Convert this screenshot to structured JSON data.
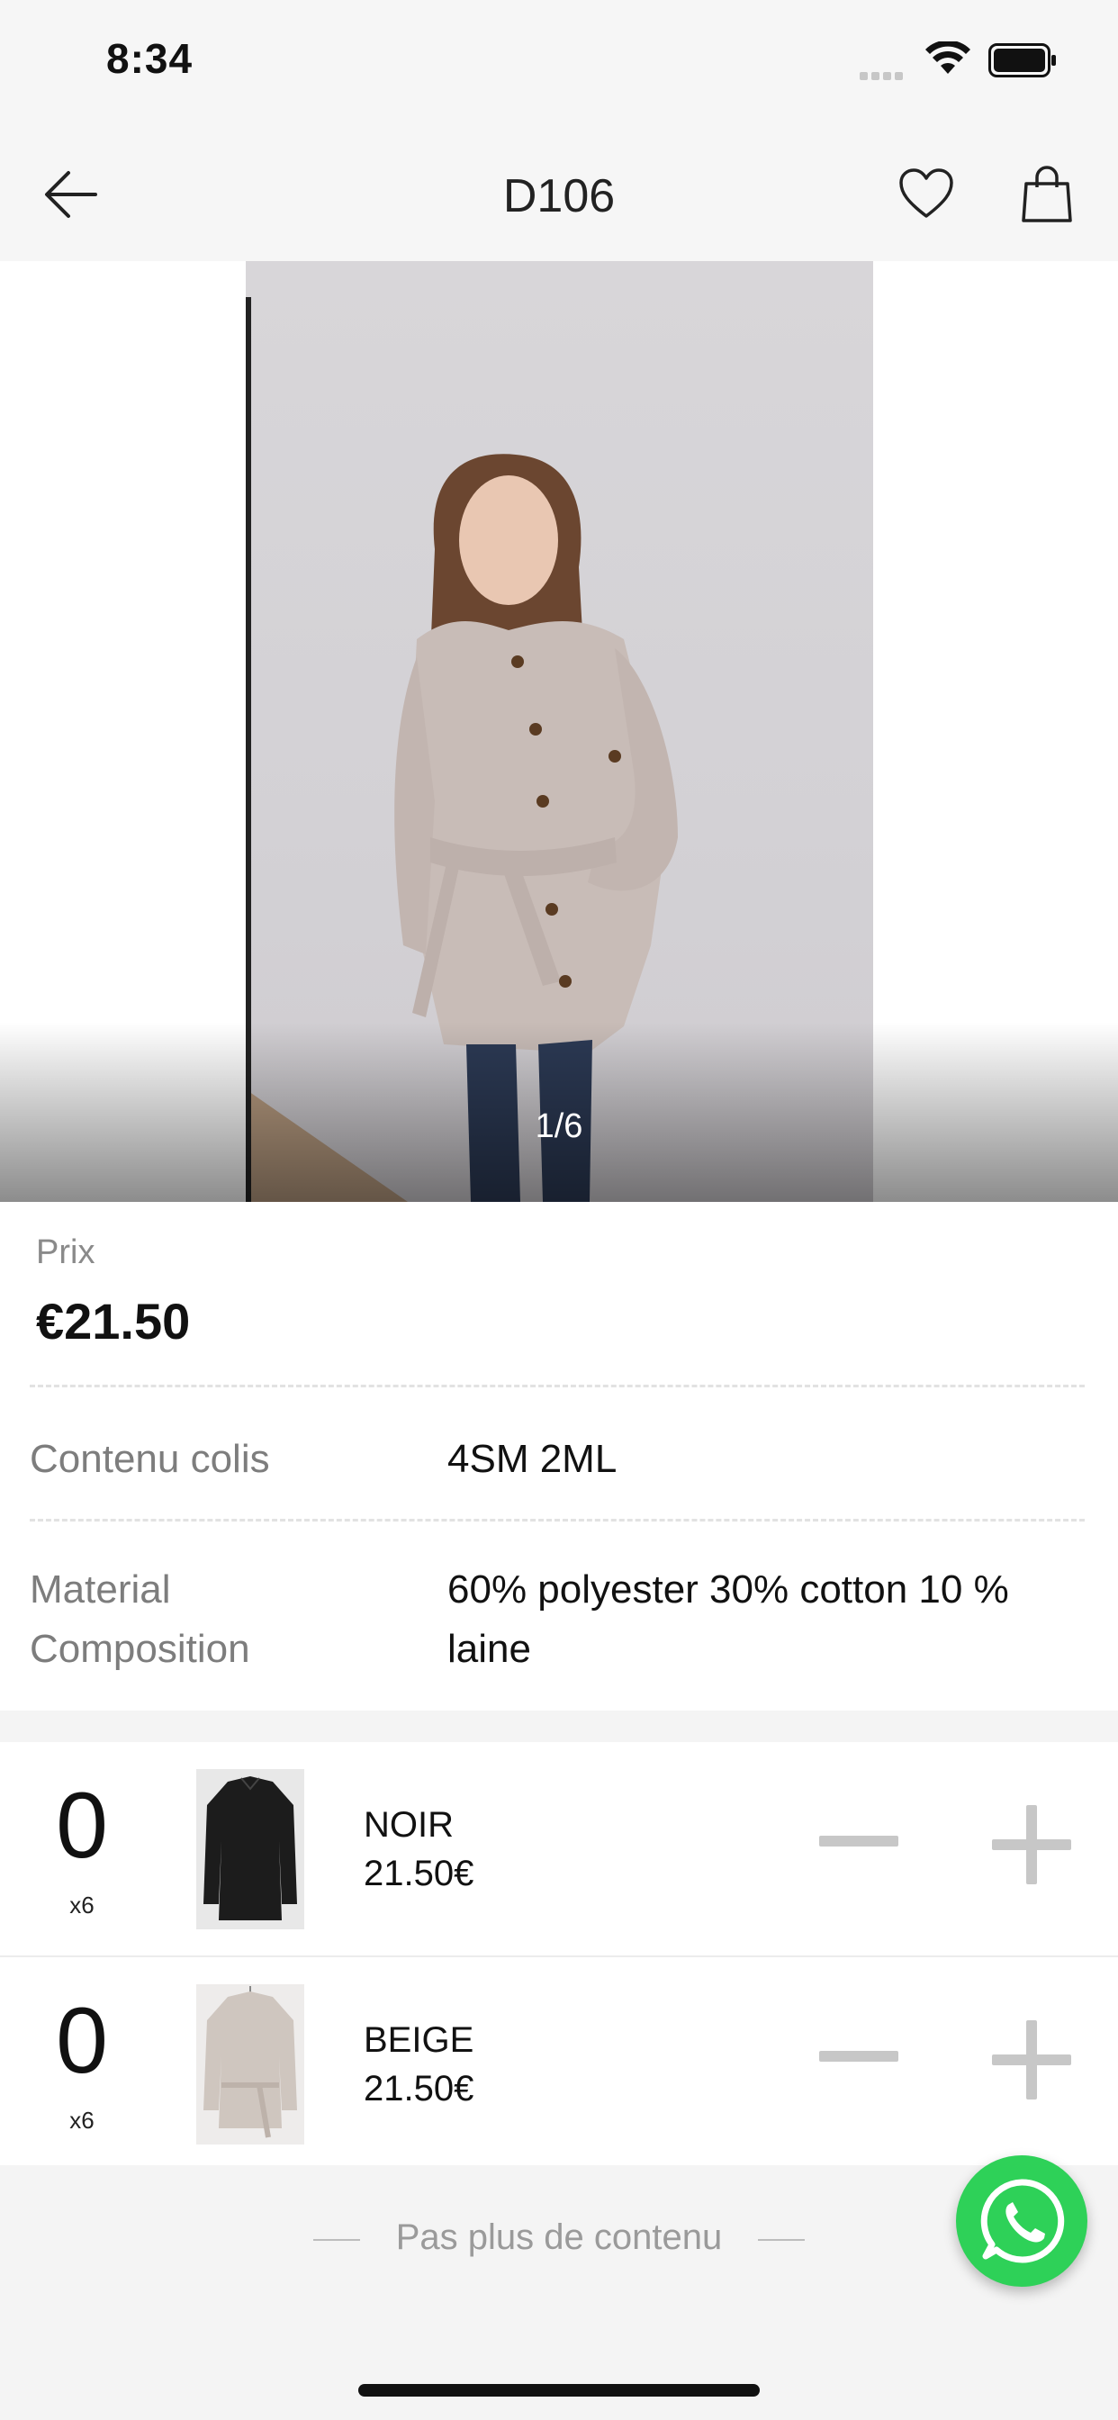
{
  "status_bar": {
    "time": "8:34"
  },
  "nav": {
    "title": "D106"
  },
  "gallery": {
    "counter": "1/6"
  },
  "price": {
    "label": "Prix",
    "value": "€21.50"
  },
  "details": [
    {
      "label": "Contenu colis",
      "value": "4SM 2ML"
    },
    {
      "label_line1": "Material",
      "label_line2": "Composition",
      "value_line1": "60% polyester 30% cotton 10 %",
      "value_line2": "laine"
    }
  ],
  "variants": [
    {
      "quantity": "0",
      "multiplier": "x6",
      "color": "NOIR",
      "price": "21.50€"
    },
    {
      "quantity": "0",
      "multiplier": "x6",
      "color": "BEIGE",
      "price": "21.50€"
    }
  ],
  "footer": {
    "text": "Pas plus de contenu"
  },
  "colors": {
    "whatsapp": "#2ed158",
    "accent_text": "#111111"
  }
}
